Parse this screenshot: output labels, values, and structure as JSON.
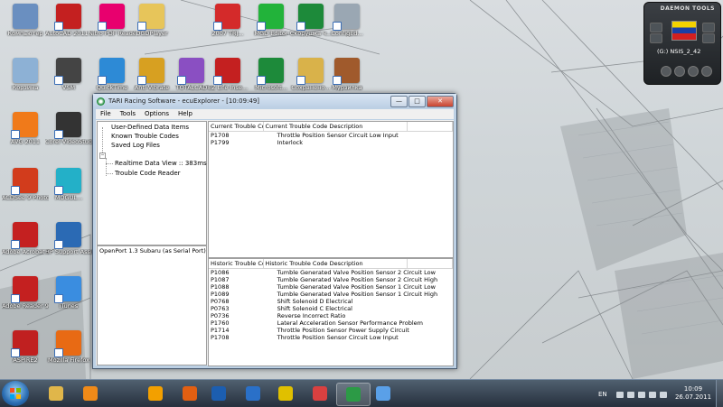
{
  "desktop": {
    "icons": [
      {
        "label": "Компьютер",
        "color": "#6a8fc0"
      },
      {
        "label": "AutoCAD 2011 -...",
        "color": "#c42020"
      },
      {
        "label": "Nitro PDF Reader",
        "color": "#e8006e"
      },
      {
        "label": "DGDPlayer",
        "color": "#e7c55a"
      },
      {
        "label": "2007 TRJ...",
        "color": "#d42a2a"
      },
      {
        "label": "MGD Editor",
        "color": "#22b33a"
      },
      {
        "label": "Скорушка ч...",
        "color": "#1d8a3a"
      },
      {
        "label": "ConfigEd...",
        "color": "#9aa7b3"
      },
      {
        "label": "Корзина",
        "color": "#8db1d5"
      },
      {
        "label": "VSM",
        "color": "#444444"
      },
      {
        "label": "QuickTime",
        "color": "#2d8ad6"
      },
      {
        "label": "Anti-Vibrate",
        "color": "#d7a021"
      },
      {
        "label": "TOTALCAD",
        "color": "#8a4fc2"
      },
      {
        "label": "EZ Life Inse...",
        "color": "#c42020"
      },
      {
        "label": "Microsoft...",
        "color": "#1d8a3a"
      },
      {
        "label": "Сохранено...",
        "color": "#d9b24a"
      },
      {
        "label": "Мурзилка",
        "color": "#a05a2c"
      },
      {
        "label": "AVG 2011",
        "color": "#f07a1a"
      },
      {
        "label": "Corel VideoStudi...",
        "color": "#333333"
      },
      {
        "label": "ACDSee 9 Photo ...",
        "color": "#d23c1c"
      },
      {
        "label": "MOGUL...",
        "color": "#23b0c8"
      },
      {
        "label": "Tes...",
        "color": "#555555"
      },
      {
        "label": "Adobe Acrobat X",
        "color": "#c42020"
      },
      {
        "label": "HP Support Assistant",
        "color": "#2b6ab4"
      },
      {
        "label": "Adobe Reader 9",
        "color": "#c42020"
      },
      {
        "label": "iTunes",
        "color": "#3a8de0"
      },
      {
        "label": "W...",
        "color": "#777777"
      },
      {
        "label": "ASPIRE2",
        "color": "#c02020"
      },
      {
        "label": "Mozilla Firefox",
        "color": "#e86a14"
      }
    ]
  },
  "gadget": {
    "title": "DAEMON TOOLS",
    "drive_letter": "(G:)",
    "drive_label": "NSIS_2_42",
    "flag_colors": [
      "#f4d200",
      "#1a3fa6",
      "#d32020"
    ]
  },
  "window": {
    "title": "TARI Racing Software - ecuExplorer - [10:09:49]",
    "controls": {
      "minimize": "—",
      "maximize": "□",
      "close": "✕"
    },
    "menu": [
      "File",
      "Tools",
      "Options",
      "Help"
    ],
    "tree": {
      "items": [
        "User-Defined Data Items",
        "Known Trouble Codes",
        "Saved Log Files"
      ],
      "children": [
        "Realtime Data View :: 383ms",
        "Trouble Code Reader"
      ]
    },
    "status_text": "OpenPort 1.3 Subaru (as Serial Port) [COM]",
    "current": {
      "headers": [
        "Current Trouble Code",
        "Current Trouble Code Description",
        ""
      ],
      "rows": [
        {
          "code": "P1708",
          "desc": "Throttle Position Sensor Circuit Low Input"
        },
        {
          "code": "P1799",
          "desc": "Interlock"
        }
      ]
    },
    "historic": {
      "headers": [
        "Historic Trouble Code",
        "Historic Trouble Code Description",
        ""
      ],
      "rows": [
        {
          "code": "P1086",
          "desc": "Tumble Generated Valve Position Sensor 2 Circuit Low"
        },
        {
          "code": "P1087",
          "desc": "Tumble Generated Valve Position Sensor 2 Circuit High"
        },
        {
          "code": "P1088",
          "desc": "Tumble Generated Valve Position Sensor 1 Circuit Low"
        },
        {
          "code": "P1089",
          "desc": "Tumble Generated Valve Position Sensor 1 Circuit High"
        },
        {
          "code": "P0768",
          "desc": "Shift Solenoid D Electrical"
        },
        {
          "code": "P0763",
          "desc": "Shift Solenoid C Electrical"
        },
        {
          "code": "P0736",
          "desc": "Reverse Incorrect Ratio"
        },
        {
          "code": "P1760",
          "desc": "Lateral Acceleration Sensor Performance Problem"
        },
        {
          "code": "P1714",
          "desc": "Throttle Position Sensor Power Supply Circuit"
        },
        {
          "code": "P1708",
          "desc": "Throttle Position Sensor Circuit Low Input"
        }
      ]
    }
  },
  "taskbar": {
    "language": "EN",
    "time": "10:09",
    "date": "26.07.2011",
    "pinned": [
      {
        "name": "explorer",
        "color": "#e0b64a"
      },
      {
        "name": "media-player",
        "color": "#f08a18"
      },
      {
        "name": "outlook",
        "color": "#f3a000"
      },
      {
        "name": "firefox",
        "color": "#e25f12"
      },
      {
        "name": "hp",
        "color": "#1c5eb0"
      },
      {
        "name": "checkmark-app",
        "color": "#2a70c8"
      },
      {
        "name": "1c",
        "color": "#e0c000"
      },
      {
        "name": "notepad-app",
        "color": "#d94040"
      },
      {
        "name": "ecuexplorer",
        "color": "#2c9a46"
      },
      {
        "name": "picasa",
        "color": "#5aa0e8"
      }
    ]
  }
}
